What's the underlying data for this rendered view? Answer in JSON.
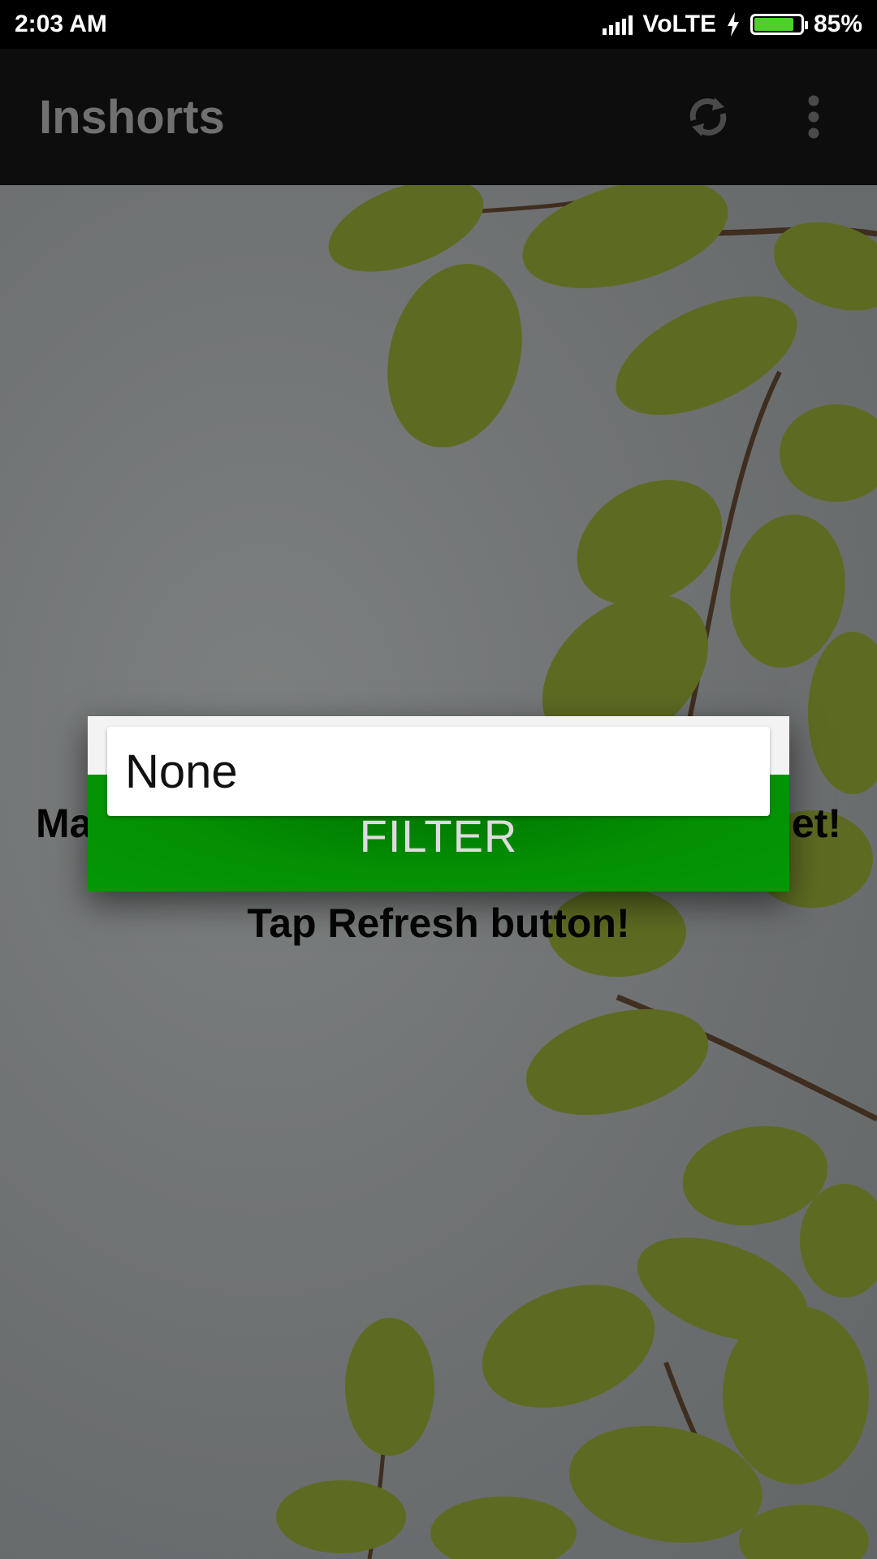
{
  "status_bar": {
    "time": "2:03 AM",
    "network": "VoLTE",
    "battery": "85%",
    "battery_level": 0.85
  },
  "toolbar": {
    "title": "Inshorts",
    "refresh_icon": "refresh-icon",
    "menu_icon": "more-vert-icon"
  },
  "background": {
    "message_left": "Ma",
    "message_right": "et!",
    "message_hint": "Tap Refresh button!"
  },
  "dialog": {
    "selected_filter": "None",
    "filter_button": "FILTER"
  },
  "colors": {
    "accent_green": "#049704",
    "battery_green": "#4dd12a",
    "toolbar_bg": "#0d0d0d"
  }
}
